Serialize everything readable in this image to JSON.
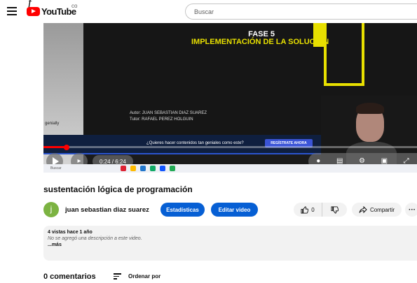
{
  "header": {
    "logo_text": "YouTube",
    "logo_country": "co",
    "search_placeholder": "Buscar",
    "corner_mark": "f"
  },
  "player": {
    "slide": {
      "fase": "FASE 5",
      "heading": "IMPLEMENTACIÓN DE LA SOLUCIÓN",
      "autor": "Autor: JUAN SEBASTIAN DIAZ SUAREZ",
      "tutor": "Tutor: RAFAEL PEREZ HOLGUIN",
      "brand_label": "genially",
      "promo_text": "¿Quieres hacer contenidos tan geniales como este?",
      "promo_button": "REGÍSTRATE AHORA"
    },
    "time": "0:24 / 6:24",
    "progress_fraction": 0.0625,
    "taskbar_search": "Buscar",
    "accent_color": "#ff0000"
  },
  "video": {
    "title": "sustentación lógica de programación",
    "channel_initial": "j",
    "channel_name": "juan sebastian diaz suarez",
    "stats_button": "Estadísticas",
    "edit_button": "Editar video",
    "like_count": "0",
    "share_label": "Compartir",
    "more_label": "···",
    "button_color": "#065fd4"
  },
  "description": {
    "meta": "4 vistas  hace 1 año",
    "text": "No se agregó una descripción a este video.",
    "more": "...más"
  },
  "comments": {
    "count_label": "0 comentarios",
    "sort_label": "Ordenar por"
  }
}
